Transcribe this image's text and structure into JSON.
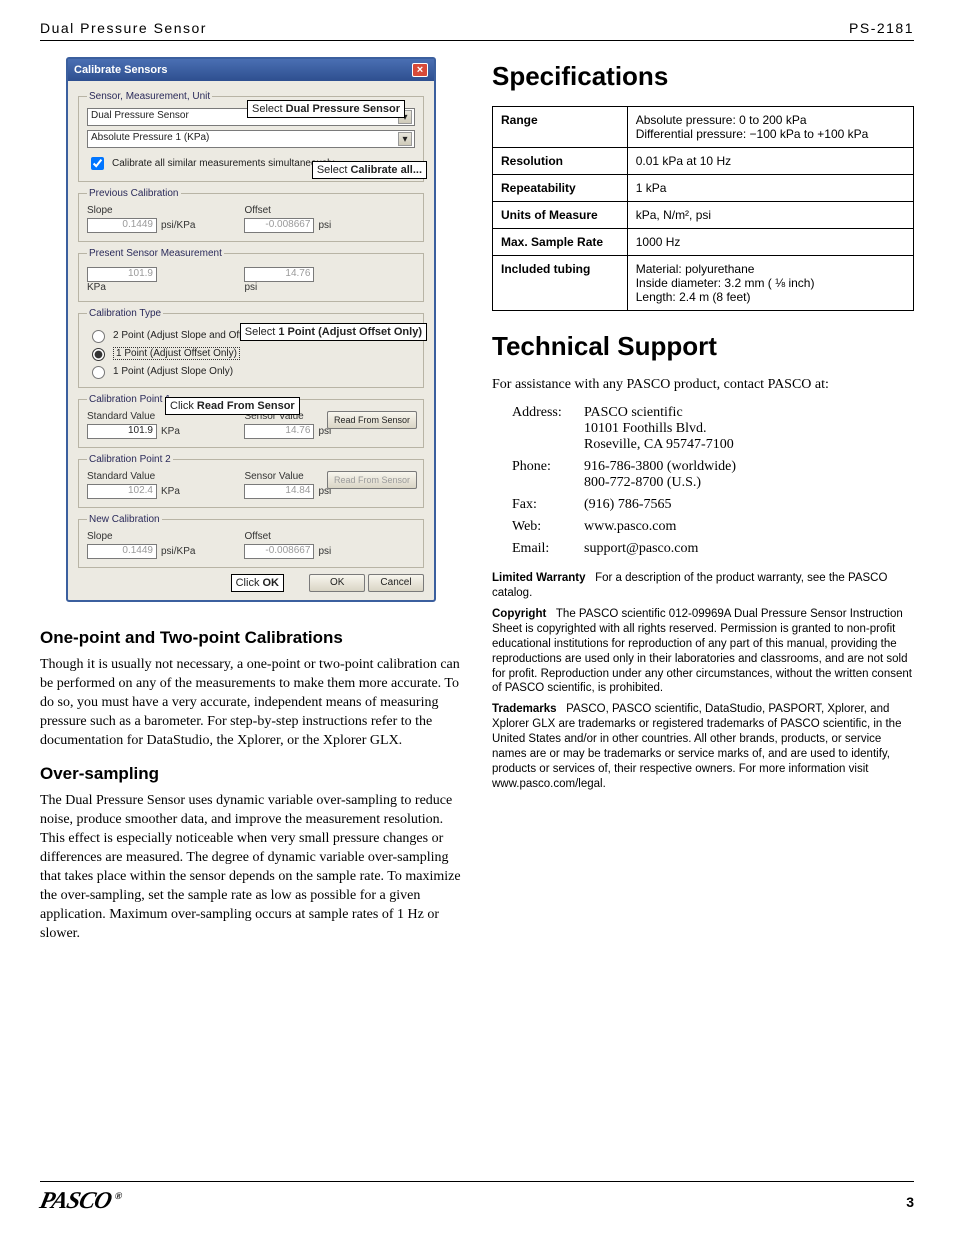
{
  "header": {
    "left": "Dual Pressure Sensor",
    "right": "PS-2181"
  },
  "dialog": {
    "title": "Calibrate Sensors",
    "grp_smu": "Sensor, Measurement, Unit",
    "dd_sensor": "Dual Pressure Sensor",
    "dd_meas": "Absolute Pressure 1 (KPa)",
    "chk_all": "Calibrate all similar measurements simultaneously.",
    "callout_sensor": "Select Dual Pressure Sensor",
    "callout_caliball": "Select Calibrate all...",
    "grp_prev": "Previous Calibration",
    "slope_lbl": "Slope",
    "offset_lbl": "Offset",
    "prev_slope": "0.1449",
    "prev_slope_u": "psi/KPa",
    "prev_offset": "-0.008667",
    "prev_offset_u": "psi",
    "grp_present": "Present Sensor Measurement",
    "present_v": "101.9",
    "present_u": "KPa",
    "present_v2": "14.76",
    "present_u2": "psi",
    "grp_ctype": "Calibration Type",
    "r1": "2 Point (Adjust Slope and Offset)",
    "r2": "1 Point (Adjust Offset Only)",
    "r3": "1 Point (Adjust Slope Only)",
    "callout_1pt": "Select 1 Point (Adjust Offset Only)",
    "grp_cp1": "Calibration Point 1",
    "stdval": "Standard Value",
    "senval": "Sensor Value",
    "cp1_v": "101.9",
    "cp1_u": "KPa",
    "cp1_sv": "14.76",
    "cp1_su": "psi",
    "read_btn": "Read From Sensor",
    "callout_read": "Click Read From Sensor",
    "grp_cp2": "Calibration Point 2",
    "cp2_v": "102.4",
    "cp2_u": "KPa",
    "cp2_sv": "14.84",
    "cp2_su": "psi",
    "grp_new": "New Calibration",
    "new_slope": "0.1449",
    "new_offset": "-0.008667",
    "callout_ok": "Click OK",
    "ok": "OK",
    "cancel": "Cancel"
  },
  "sec1": {
    "h": "One-point and Two-point Calibrations",
    "p": "Though it is usually not necessary, a one-point or two-point calibration can be performed on any of the measurements to make them more accurate. To do so, you must have a very accurate, independent means of measuring pressure such as a barometer. For step-by-step instructions refer to the documentation for DataStudio, the Xplorer, or the Xplorer GLX."
  },
  "sec2": {
    "h": "Over-sampling",
    "p": "The Dual Pressure Sensor uses dynamic variable over-sampling to reduce noise, produce smoother data, and improve the measurement resolution. This effect is especially noticeable when very small pressure changes or differences are measured. The degree of dynamic variable over-sampling that takes place within the sensor depends on the sample rate. To maximize the over-sampling, set the sample rate as low as possible for a given application. Maximum over-sampling occurs at sample rates of 1 Hz or slower."
  },
  "right": {
    "spec_h": "Specifications",
    "spec_rows": [
      {
        "k": "Range",
        "v": "Absolute pressure: 0 to 200 kPa\nDifferential pressure: −100 kPa to +100 kPa"
      },
      {
        "k": "Resolution",
        "v": "0.01 kPa at 10 Hz"
      },
      {
        "k": "Repeatability",
        "v": "1 kPa"
      },
      {
        "k": "Units of Measure",
        "v": "kPa, N/m², psi"
      },
      {
        "k": "Max. Sample Rate",
        "v": "1000 Hz"
      },
      {
        "k": "Included tubing",
        "v": "Material: polyurethane\nInside diameter: 3.2 mm ( ⅛ inch)\nLength: 2.4 m (8 feet)"
      }
    ],
    "ts_h": "Technical Support",
    "ts_p": "For assistance with any PASCO product, contact PASCO at:",
    "contact": {
      "Address:": "PASCO scientific\n10101 Foothills Blvd.\nRoseville, CA 95747-7100",
      "Phone:": "916-786-3800 (worldwide)\n800-772-8700 (U.S.)",
      "Fax:": "(916) 786-7565",
      "Web:": "www.pasco.com",
      "Email:": "support@pasco.com"
    },
    "fine": [
      {
        "b": "Limited Warranty",
        "t": "For a description of the product warranty, see the PASCO catalog."
      },
      {
        "b": "Copyright",
        "t": "The PASCO scientific 012-09969A Dual Pressure Sensor Instruction Sheet is copyrighted with all rights reserved. Permission is granted to non-profit educational institutions for reproduction of any part of this manual, providing the reproductions are used only in their laboratories and classrooms, and are not sold for profit. Reproduction under any other circumstances, without the written consent of PASCO scientific, is prohibited."
      },
      {
        "b": "Trademarks",
        "t": "PASCO, PASCO scientific, DataStudio, PASPORT, Xplorer, and Xplorer GLX are trademarks or registered trademarks of PASCO scientific, in the United States and/or in other countries. All other brands, products, or service names are or may be trademarks or service marks of, and are used to identify, products or services of, their respective owners. For more information visit www.pasco.com/legal."
      }
    ]
  },
  "footer": {
    "logo": "PASCO",
    "reg": "®",
    "page": "3"
  }
}
